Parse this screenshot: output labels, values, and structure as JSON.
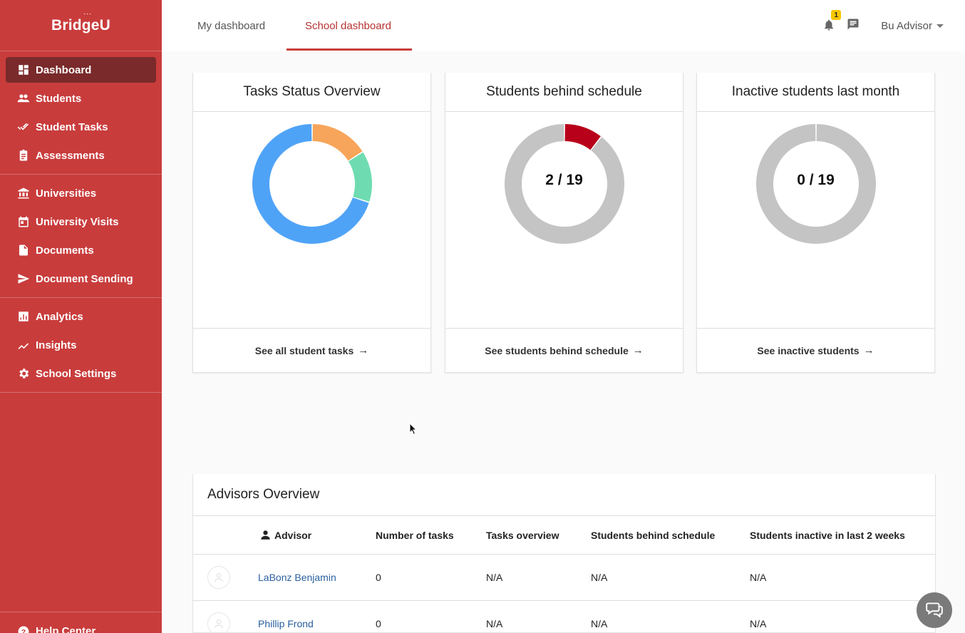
{
  "sidebar": {
    "logo": "BridgeU",
    "groups": [
      [
        {
          "label": "Dashboard",
          "icon": "dashboard-icon",
          "active": true
        },
        {
          "label": "Students",
          "icon": "people-icon"
        },
        {
          "label": "Student Tasks",
          "icon": "double-check-icon"
        },
        {
          "label": "Assessments",
          "icon": "clipboard-icon"
        }
      ],
      [
        {
          "label": "Universities",
          "icon": "bank-icon"
        },
        {
          "label": "University Visits",
          "icon": "calendar-icon"
        },
        {
          "label": "Documents",
          "icon": "document-icon"
        },
        {
          "label": "Document Sending",
          "icon": "send-icon"
        }
      ],
      [
        {
          "label": "Analytics",
          "icon": "bar-chart-icon"
        },
        {
          "label": "Insights",
          "icon": "trend-icon"
        },
        {
          "label": "School Settings",
          "icon": "gear-icon"
        }
      ]
    ],
    "help": "Help Center"
  },
  "topbar": {
    "tabs": [
      "My dashboard",
      "School dashboard"
    ],
    "active_tab": "School dashboard",
    "notification_count": "1",
    "user": "Bu Advisor"
  },
  "cards": [
    {
      "title": "Tasks Status Overview",
      "footer": "See all student tasks",
      "chart_data": {
        "type": "pie",
        "segments": [
          {
            "value": 16,
            "color": "#f7a55a"
          },
          {
            "value": 14,
            "color": "#6edcb0"
          },
          {
            "value": 70,
            "color": "#4fa3f7"
          }
        ]
      }
    },
    {
      "title": "Students behind schedule",
      "footer": "See students behind schedule",
      "ratio": "2 / 19",
      "chart_data": {
        "type": "pie",
        "segments": [
          {
            "value": 2,
            "color": "#b8001a"
          },
          {
            "value": 17,
            "color": "#c4c4c4"
          }
        ]
      }
    },
    {
      "title": "Inactive students last month",
      "footer": "See inactive students",
      "ratio": "0 / 19",
      "chart_data": {
        "type": "pie",
        "segments": [
          {
            "value": 0,
            "color": "#b8001a"
          },
          {
            "value": 19,
            "color": "#c4c4c4"
          }
        ]
      }
    }
  ],
  "advisors": {
    "title": "Advisors Overview",
    "columns": [
      "Advisor",
      "Number of tasks",
      "Tasks overview",
      "Students behind schedule",
      "Students inactive in last 2 weeks"
    ],
    "rows": [
      {
        "name": "LaBonz Benjamin",
        "tasks": "0",
        "overview": "N/A",
        "behind": "N/A",
        "inactive": "N/A"
      },
      {
        "name": "Phillip Frond",
        "tasks": "0",
        "overview": "N/A",
        "behind": "N/A",
        "inactive": "N/A"
      }
    ]
  }
}
